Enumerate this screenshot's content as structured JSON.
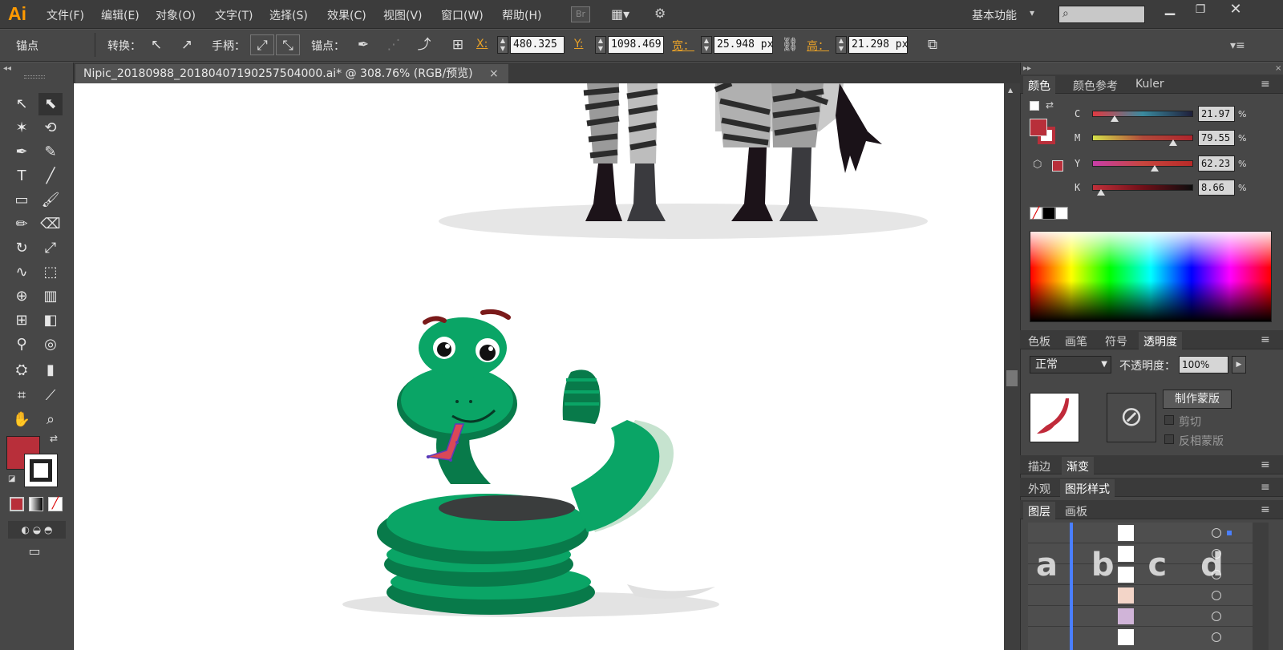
{
  "app": {
    "logo": "Ai",
    "workspace": "基本功能",
    "workspace_arrow": "▾",
    "search_placeholder": "",
    "br_label": "Br"
  },
  "menus": [
    "文件(F)",
    "编辑(E)",
    "对象(O)",
    "文字(T)",
    "选择(S)",
    "效果(C)",
    "视图(V)",
    "窗口(W)",
    "帮助(H)"
  ],
  "control": {
    "anchor_label": "锚点",
    "convert_label": "转换：",
    "handle_label": "手柄：",
    "anchor2_label": "锚点：",
    "x_label": "X:",
    "x_value": "480.325 p",
    "y_label": "Y:",
    "y_value": "1098.469",
    "w_label": "宽：",
    "w_value": "25.948 px",
    "h_label": "高：",
    "h_value": "21.298 px"
  },
  "document": {
    "tab_title": "Nipic_20180988_20180407190257504000.ai* @ 308.76% (RGB/预览)",
    "close": "×"
  },
  "color_panel": {
    "tabs": [
      "颜色",
      "颜色参考",
      "Kuler"
    ],
    "channels": [
      {
        "name": "C",
        "value": "21.97",
        "level": 0.22,
        "gradient": "linear-gradient(90deg,#e03a42,#3a8a9e,#1f1f3a)"
      },
      {
        "name": "M",
        "value": "79.55",
        "level": 0.8,
        "gradient": "linear-gradient(90deg,#d4e04a,#b04a3a,#b0252d)"
      },
      {
        "name": "Y",
        "value": "62.23",
        "level": 0.62,
        "gradient": "linear-gradient(90deg,#c83ea8,#c8463e,#b82a28)"
      },
      {
        "name": "K",
        "value": "8.66",
        "level": 0.09,
        "gradient": "linear-gradient(90deg,#c0303a,#700f18,#0e0e0e)"
      }
    ],
    "percent": "%",
    "fill": "#b82f3a"
  },
  "transparency_panel": {
    "tabs": [
      "色板",
      "画笔",
      "符号",
      "透明度"
    ],
    "blend_mode": "正常",
    "opacity_label": "不透明度：",
    "opacity_value": "100%",
    "make_mask": "制作蒙版",
    "clip": "剪切",
    "invert_mask": "反相蒙版"
  },
  "stroke_panel": {
    "tabs": [
      "描边",
      "渐变"
    ]
  },
  "appearance_panel": {
    "tabs": [
      "外观",
      "图形样式"
    ]
  },
  "layers_panel": {
    "tabs": [
      "图层",
      "画板"
    ],
    "watermark": "a b c d"
  },
  "colors": {
    "accent": "#b82f3a",
    "snake": "#0aa566",
    "snake_dark": "#087a4a"
  }
}
